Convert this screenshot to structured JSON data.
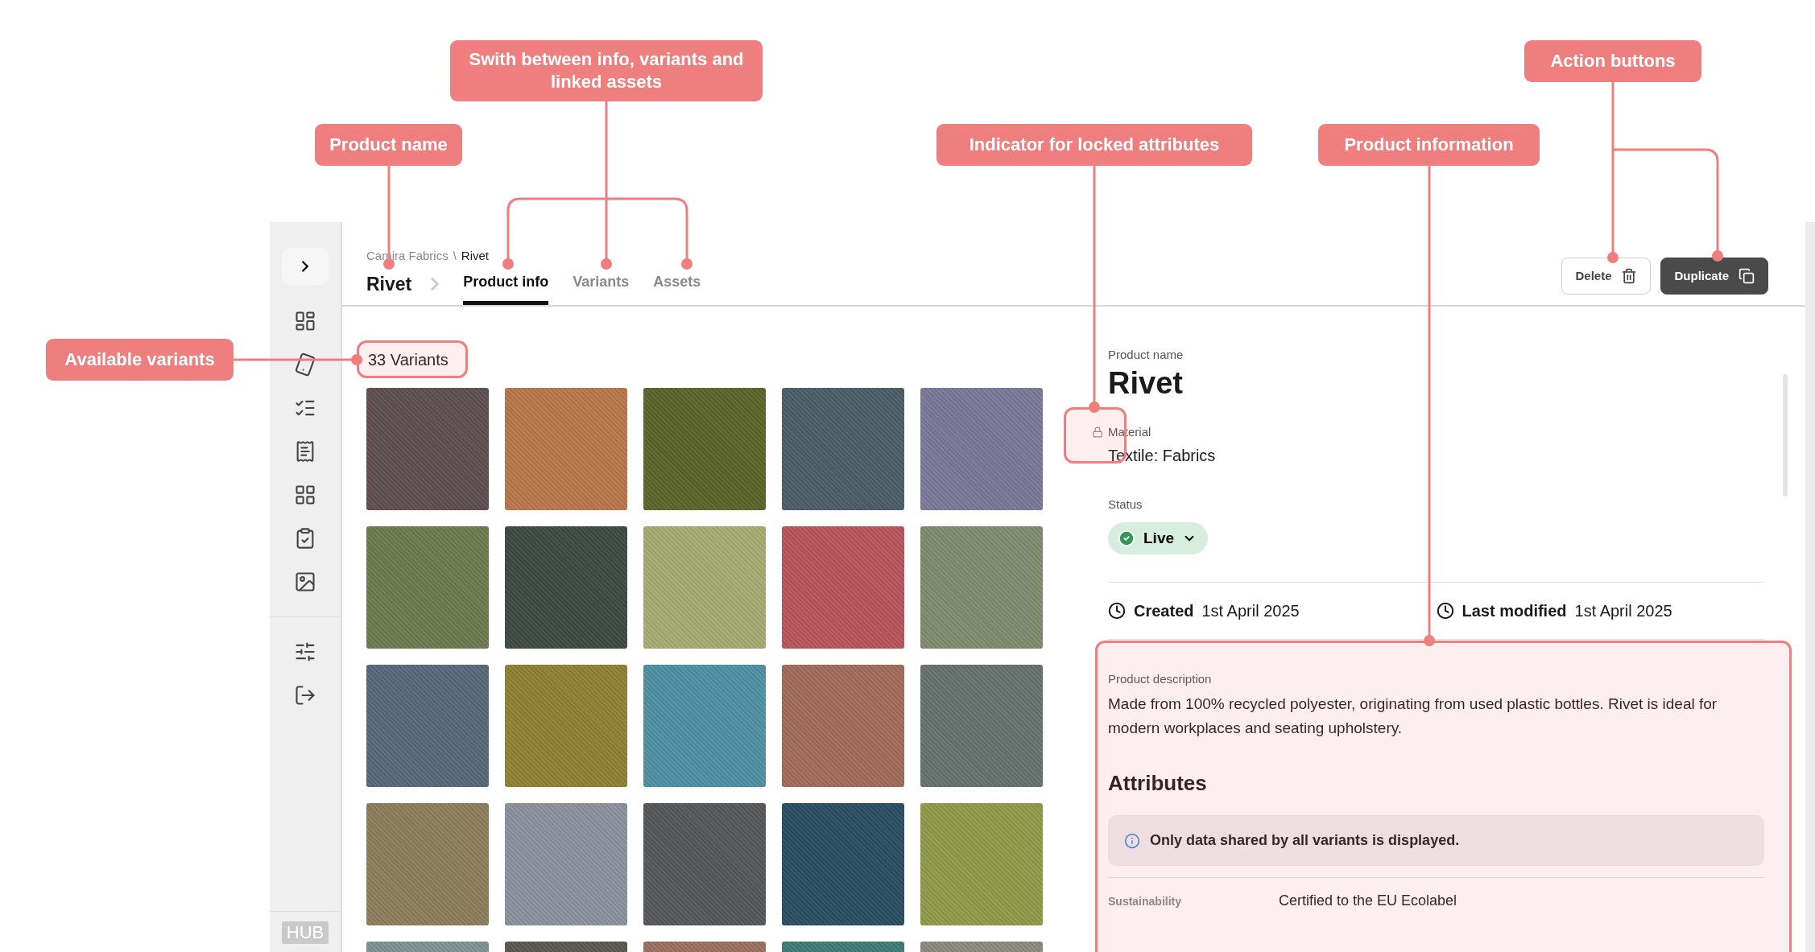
{
  "annotations": [
    "Swith between info, variants and linked assets",
    "Product name",
    "Indicator for locked attributes",
    "Product information",
    "Action buttons",
    "Available variants"
  ],
  "sidebar": {
    "brand": "HUB"
  },
  "breadcrumb": {
    "items": [
      {
        "label": "Camira Fabrics",
        "current": false
      },
      {
        "label": "Rivet",
        "current": true
      }
    ],
    "separator": "\\"
  },
  "title": "Rivet",
  "tabs": [
    {
      "label": "Product info",
      "selected": true
    },
    {
      "label": "Variants",
      "selected": false
    },
    {
      "label": "Assets",
      "selected": false
    }
  ],
  "actions": [
    {
      "label": "Delete",
      "kind": "secondary"
    },
    {
      "label": "Duplicate",
      "kind": "primary"
    }
  ],
  "variants": {
    "count_label": "33 Variants",
    "swatches": [
      {
        "color": "#5e4f50"
      },
      {
        "color": "#b8774a"
      },
      {
        "color": "#5a6428"
      },
      {
        "color": "#4b5c68"
      },
      {
        "color": "#7a7898"
      },
      {
        "color": "#6d7a4f"
      },
      {
        "color": "#3c4a44"
      },
      {
        "color": "#a6aa72"
      },
      {
        "color": "#b8545a"
      },
      {
        "color": "#7f8a6c"
      },
      {
        "color": "#58687a"
      },
      {
        "color": "#8f8233"
      },
      {
        "color": "#4f8fa4"
      },
      {
        "color": "#a06a5a"
      },
      {
        "color": "#66716c"
      },
      {
        "color": "#8c7d5c"
      },
      {
        "color": "#8a929c"
      },
      {
        "color": "#545659"
      },
      {
        "color": "#294e62"
      },
      {
        "color": "#8e9a48"
      },
      {
        "color": "#7d9294"
      },
      {
        "color": "#5a5650"
      },
      {
        "color": "#9a6f60"
      },
      {
        "color": "#3f7a78"
      },
      {
        "color": "#8a8a80"
      }
    ]
  },
  "details": {
    "fields": [
      {
        "label": "Product name",
        "value": "Rivet",
        "kind": "title",
        "locked": false
      },
      {
        "label": "Material",
        "value": "Textile: Fabrics",
        "kind": "text",
        "locked": true
      }
    ],
    "status": {
      "label": "Status",
      "value": "Live"
    },
    "dates": [
      {
        "label": "Created",
        "value": "1st April 2025"
      },
      {
        "label": "Last modified",
        "value": "1st April 2025"
      }
    ],
    "description": {
      "label": "Product description",
      "text": "Made from 100% recycled polyester, originating from used plastic bottles. Rivet is ideal for modern workplaces and seating upholstery."
    },
    "attributes": {
      "heading": "Attributes",
      "notice": "Only data shared by all variants is displayed.",
      "rows": [
        {
          "name": "Sustainability",
          "value": "Certified to the EU Ecolabel"
        }
      ]
    }
  }
}
